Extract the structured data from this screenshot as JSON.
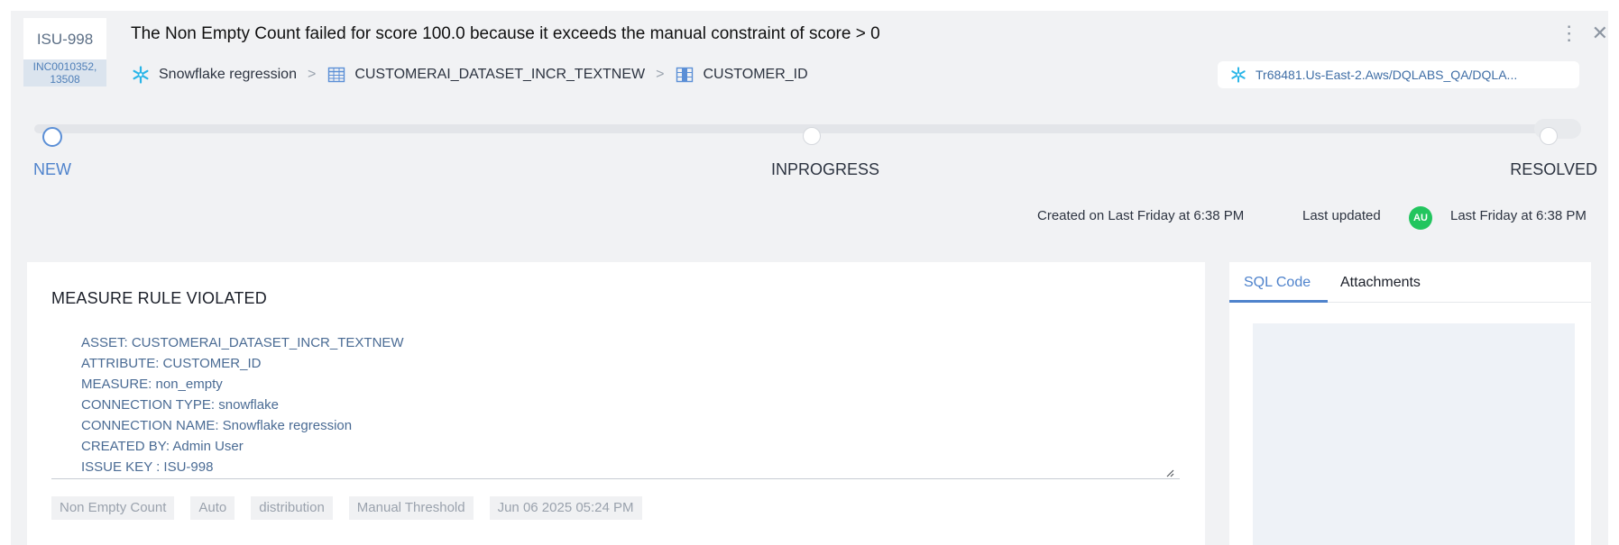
{
  "issue": {
    "id": "ISU-998",
    "incident": "INC0010352, 13508",
    "title": "The Non Empty Count failed for score 100.0 because it exceeds the manual constraint of score > 0"
  },
  "breadcrumb": {
    "connection": "Snowflake regression",
    "dataset": "CUSTOMERAI_DATASET_INCR_TEXTNEW",
    "attribute": "CUSTOMER_ID",
    "separator": ">"
  },
  "connection_path": "Tr68481.Us-East-2.Aws/DQLABS_QA/DQLA...",
  "actions": {
    "more_icon": "⋮",
    "close_icon": "✕"
  },
  "status": {
    "stages": [
      "NEW",
      "INPROGRESS",
      "RESOLVED"
    ],
    "current": "NEW"
  },
  "meta": {
    "created": "Created on Last Friday at 6:38 PM",
    "updated_label": "Last updated",
    "avatar": "AU",
    "updated_time": "Last Friday at 6:38 PM"
  },
  "main": {
    "heading": "MEASURE RULE VIOLATED",
    "description_lines": [
      "ASSET: CUSTOMERAI_DATASET_INCR_TEXTNEW",
      "ATTRIBUTE: CUSTOMER_ID",
      "MEASURE: non_empty",
      "CONNECTION TYPE: snowflake",
      "CONNECTION NAME: Snowflake regression",
      "CREATED BY: Admin User",
      "ISSUE KEY : ISU-998"
    ],
    "tags": [
      "Non Empty Count",
      "Auto",
      "distribution",
      "Manual Threshold",
      "Jun 06 2025 05:24 PM"
    ]
  },
  "side": {
    "tabs": [
      "SQL Code",
      "Attachments"
    ],
    "active_tab": "SQL Code"
  },
  "colors": {
    "accent": "#4f83cc",
    "snowflake": "#29b5e8",
    "avatar": "#22c55e",
    "panel": "#f1f2f4"
  }
}
